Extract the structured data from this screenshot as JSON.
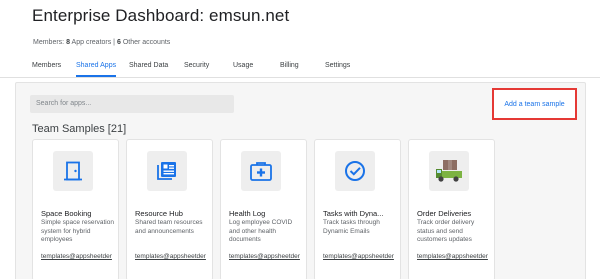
{
  "header": {
    "title": "Enterprise Dashboard: emsun.net",
    "members_label": "Members:",
    "app_creators_count": "8",
    "app_creators_label": "App creators |",
    "other_accounts_count": "6",
    "other_accounts_label": "Other accounts"
  },
  "tabs": [
    {
      "label": "Members",
      "active": false
    },
    {
      "label": "Shared Apps",
      "active": true
    },
    {
      "label": "Shared Data",
      "active": false
    },
    {
      "label": "Security",
      "active": false
    },
    {
      "label": "Usage",
      "active": false
    },
    {
      "label": "Billing",
      "active": false
    },
    {
      "label": "Settings",
      "active": false
    }
  ],
  "search": {
    "placeholder": "Search for apps..."
  },
  "add_sample_label": "Add a team sample",
  "section_title": "Team Samples [21]",
  "cards": [
    {
      "name": "Space Booking",
      "description": "Simple space reservation system for hybrid employees",
      "author": "templates@appsheetder",
      "icon": "door-icon"
    },
    {
      "name": "Resource Hub",
      "description": "Shared team resources and announcements",
      "author": "templates@appsheetder",
      "icon": "newspaper-icon"
    },
    {
      "name": "Health Log",
      "description": "Log employee COVID and other health documents",
      "author": "templates@appsheetder",
      "icon": "medical-case-icon"
    },
    {
      "name": "Tasks with Dyna...",
      "description": "Track tasks through Dynamic Emails",
      "author": "templates@appsheetder",
      "icon": "check-circle-icon"
    },
    {
      "name": "Order Deliveries",
      "description": "Track order delivery status and send customers updates",
      "author": "templates@appsheetder",
      "icon": "delivery-truck-icon"
    }
  ],
  "colors": {
    "accent": "#1a73e8",
    "highlight": "#e53935"
  }
}
